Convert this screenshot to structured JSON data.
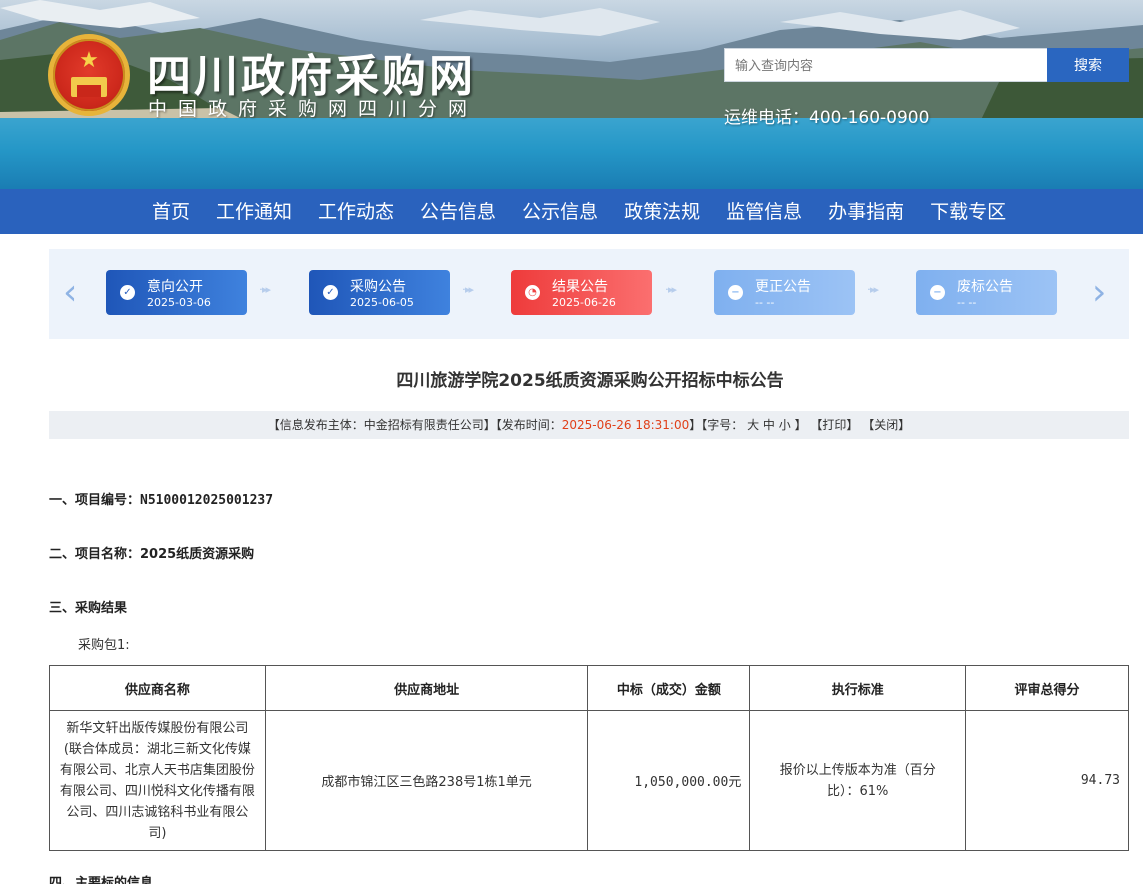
{
  "header": {
    "site_title": "四川政府采购网",
    "site_subtitle": "中国政府采购网四川分网",
    "search_placeholder": "输入查询内容",
    "search_button": "搜索",
    "hotline": "运维电话：400-160-0900"
  },
  "nav": {
    "items": [
      "首页",
      "工作通知",
      "工作动态",
      "公告信息",
      "公示信息",
      "政策法规",
      "监管信息",
      "办事指南",
      "下载专区"
    ]
  },
  "steps": [
    {
      "label": "意向公开",
      "date": "2025-03-06",
      "state": "done",
      "icon": "check-icon"
    },
    {
      "label": "采购公告",
      "date": "2025-06-05",
      "state": "done",
      "icon": "check-icon"
    },
    {
      "label": "结果公告",
      "date": "2025-06-26",
      "state": "current",
      "icon": "clock-icon"
    },
    {
      "label": "更正公告",
      "date": "-- --",
      "state": "pending",
      "icon": "minus-icon"
    },
    {
      "label": "废标公告",
      "date": "-- --",
      "state": "pending",
      "icon": "minus-icon"
    }
  ],
  "document": {
    "title": "四川旅游学院2025纸质资源采购公开招标中标公告",
    "meta": {
      "publisher_prefix": "【信息发布主体：",
      "publisher": "中金招标有限责任公司",
      "time_prefix": "】【发布时间：",
      "time": "2025-06-26 18:31:00",
      "font_prefix": "】【字号：",
      "font_large": "大",
      "font_mid": "中",
      "font_small": "小",
      "print": "【打印】",
      "close": "【关闭】"
    },
    "section1": "一、项目编号：N5100012025001237",
    "section2": "二、项目名称：2025纸质资源采购",
    "section3": "三、采购结果",
    "package": "采购包1:",
    "section4": "四、主要标的信息",
    "table": {
      "headers": [
        "供应商名称",
        "供应商地址",
        "中标（成交）金额",
        "执行标准",
        "评审总得分"
      ],
      "rows": [
        {
          "name": "新华文轩出版传媒股份有限公司(联合体成员：湖北三新文化传媒有限公司、北京人天书店集团股份有限公司、四川悦科文化传播有限公司、四川志诚铭科书业有限公司)",
          "address": "成都市锦江区三色路238号1栋1单元",
          "amount": "1,050,000.00元",
          "standard": "报价以上传版本为准（百分比）：61%",
          "score": "94.73"
        }
      ]
    }
  },
  "colors": {
    "nav_blue": "#2a62bd",
    "step_done": "#2a5fbf",
    "step_current": "#ef4343",
    "step_pending": "#86b5f0",
    "time_red": "#e0401a"
  }
}
